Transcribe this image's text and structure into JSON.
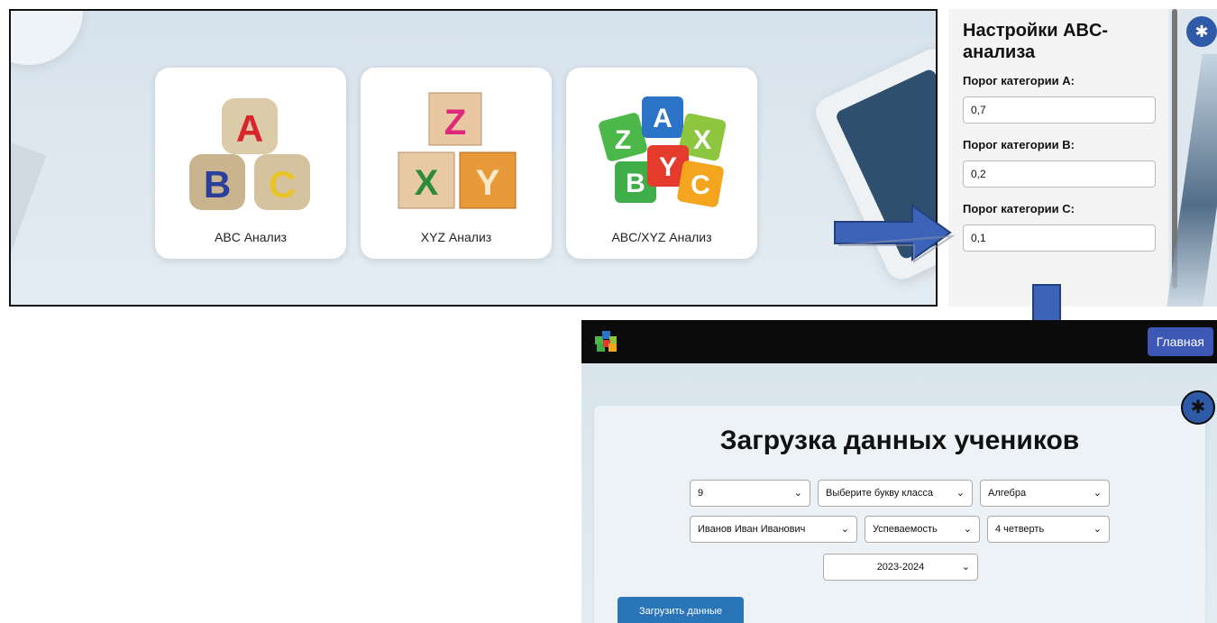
{
  "analysis_cards": [
    {
      "label": "ABC Анализ"
    },
    {
      "label": "XYZ Анализ"
    },
    {
      "label": "ABC/XYZ Анализ"
    }
  ],
  "settings": {
    "title": "Настройки ABC-анализа",
    "fields": [
      {
        "label": "Порог категории A:",
        "value": "0,7"
      },
      {
        "label": "Порог категории B:",
        "value": "0,2"
      },
      {
        "label": "Порог категории C:",
        "value": "0,1"
      }
    ],
    "gear_icon": "gear-icon"
  },
  "app": {
    "nav": {
      "home_label": "Главная"
    },
    "title": "Загрузка данных учеников",
    "selects": {
      "grade": "9",
      "class_letter": "Выберите букву класса",
      "subject": "Алгебра",
      "student": "Иванов Иван Иванович",
      "metric": "Успеваемость",
      "quarter": "4 четверть",
      "year": "2023-2024"
    },
    "load_button": "Загрузить данные"
  },
  "colors": {
    "arrow": "#3b63b8",
    "accent_blue": "#3d57b5",
    "load_button": "#2a74b8",
    "navbar": "#0b0b0b"
  }
}
